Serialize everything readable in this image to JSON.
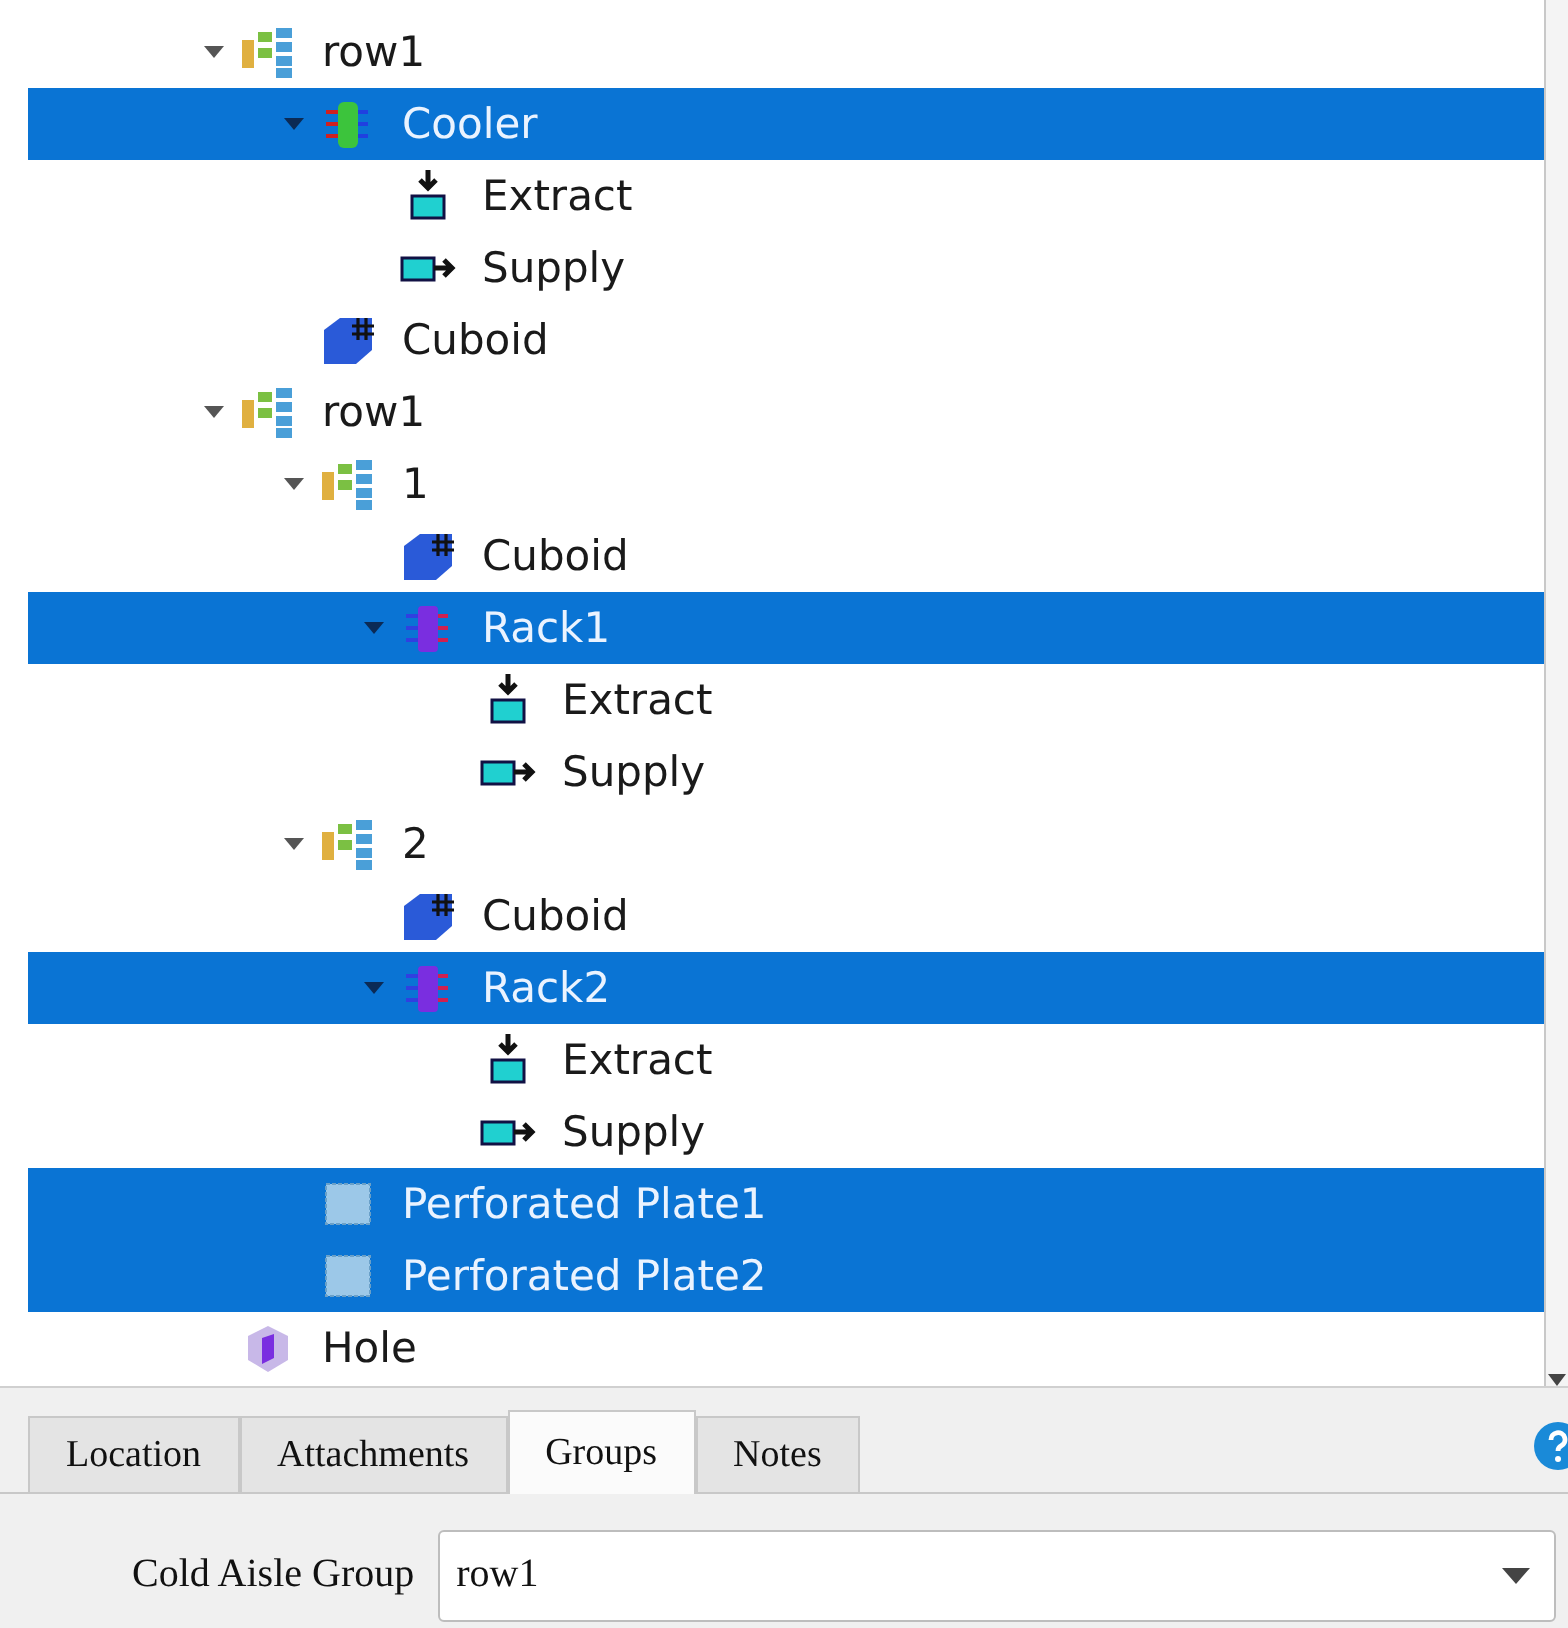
{
  "tree": [
    {
      "label": "row1",
      "kind": "group",
      "expanded": true,
      "selected": false,
      "children": [
        {
          "label": "Cooler",
          "kind": "cooler",
          "expanded": true,
          "selected": true,
          "children": [
            {
              "label": "Extract",
              "kind": "extract",
              "selected": false
            },
            {
              "label": "Supply",
              "kind": "supply",
              "selected": false
            }
          ]
        },
        {
          "label": "Cuboid",
          "kind": "cuboid",
          "selected": false
        }
      ]
    },
    {
      "label": "row1",
      "kind": "group",
      "expanded": true,
      "selected": false,
      "children": [
        {
          "label": "1",
          "kind": "group",
          "expanded": true,
          "selected": false,
          "children": [
            {
              "label": "Cuboid",
              "kind": "cuboid",
              "selected": false
            },
            {
              "label": "Rack1",
              "kind": "rack",
              "expanded": true,
              "selected": true,
              "children": [
                {
                  "label": "Extract",
                  "kind": "extract",
                  "selected": false
                },
                {
                  "label": "Supply",
                  "kind": "supply",
                  "selected": false
                }
              ]
            }
          ]
        },
        {
          "label": "2",
          "kind": "group",
          "expanded": true,
          "selected": false,
          "children": [
            {
              "label": "Cuboid",
              "kind": "cuboid",
              "selected": false
            },
            {
              "label": "Rack2",
              "kind": "rack",
              "expanded": true,
              "selected": true,
              "children": [
                {
                  "label": "Extract",
                  "kind": "extract",
                  "selected": false
                },
                {
                  "label": "Supply",
                  "kind": "supply",
                  "selected": false
                }
              ]
            }
          ]
        },
        {
          "label": "Perforated Plate1",
          "kind": "plate",
          "selected": true
        },
        {
          "label": "Perforated Plate2",
          "kind": "plate",
          "selected": true
        }
      ]
    },
    {
      "label": "Hole",
      "kind": "hole",
      "selected": false
    }
  ],
  "tabs": [
    {
      "label": "Location",
      "selected": false
    },
    {
      "label": "Attachments",
      "selected": false
    },
    {
      "label": "Groups",
      "selected": true
    },
    {
      "label": "Notes",
      "selected": false
    }
  ],
  "cold_aisle_group": {
    "label": "Cold Aisle Group",
    "value": "row1"
  }
}
